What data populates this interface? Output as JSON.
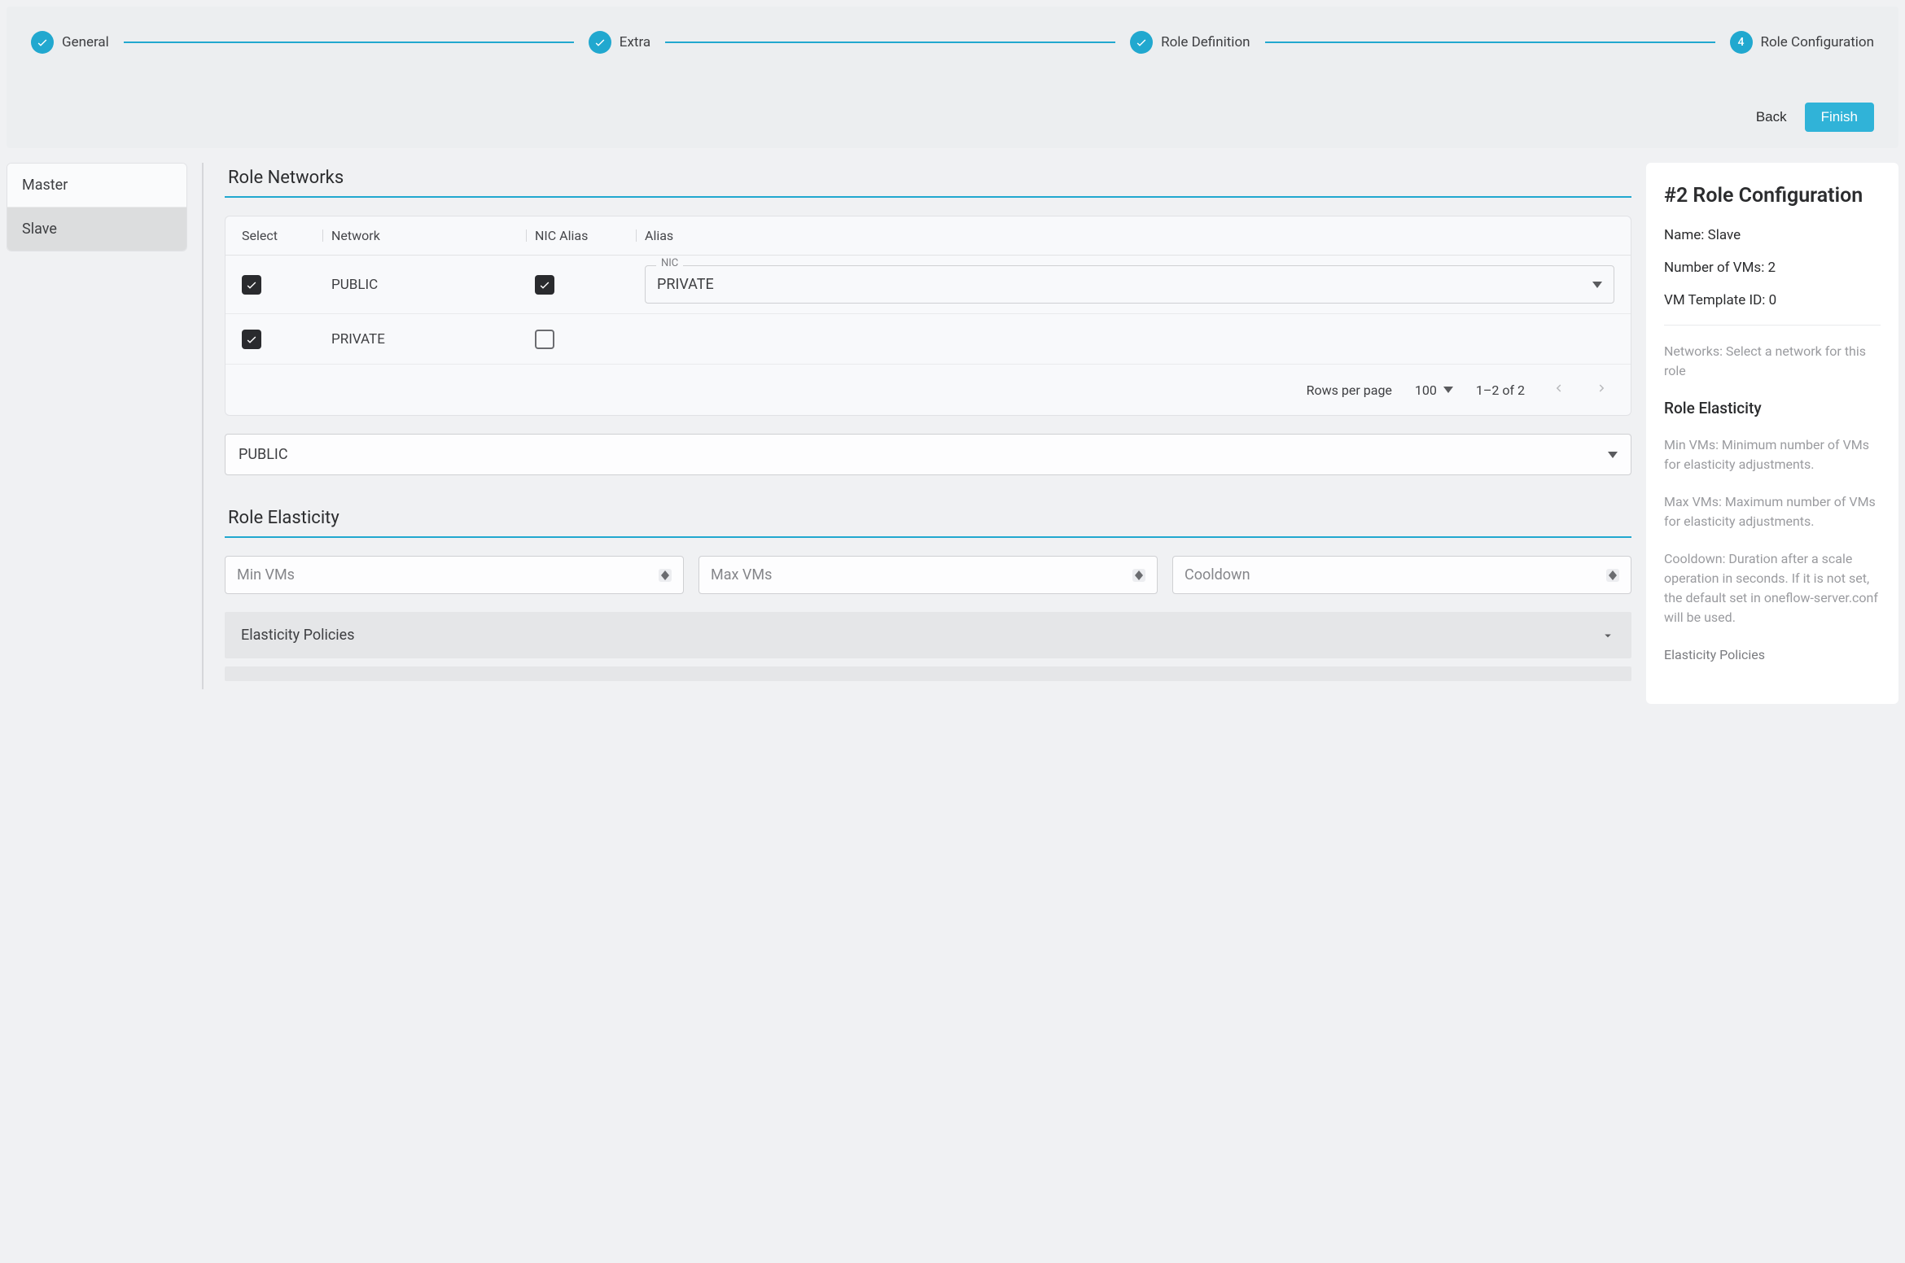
{
  "wizard": {
    "steps": [
      {
        "label": "General",
        "done": true
      },
      {
        "label": "Extra",
        "done": true
      },
      {
        "label": "Role Definition",
        "done": true
      },
      {
        "label": "Role Configuration",
        "done": false,
        "number": "4"
      }
    ],
    "back_label": "Back",
    "finish_label": "Finish"
  },
  "roles": [
    {
      "name": "Master",
      "active": false
    },
    {
      "name": "Slave",
      "active": true
    }
  ],
  "networks_section": {
    "title": "Role Networks",
    "columns": {
      "select": "Select",
      "network": "Network",
      "nic_alias": "NIC Alias",
      "alias": "Alias"
    },
    "rows": [
      {
        "selected": true,
        "network": "PUBLIC",
        "nic_alias_checked": true,
        "alias_legend": "NIC",
        "alias_value": "PRIVATE"
      },
      {
        "selected": true,
        "network": "PRIVATE",
        "nic_alias_checked": false
      }
    ],
    "footer": {
      "rows_per_page_label": "Rows per page",
      "rows_per_page_value": "100",
      "range": "1–2 of 2"
    },
    "main_select_value": "PUBLIC"
  },
  "elasticity_section": {
    "title": "Role Elasticity",
    "min_vms_placeholder": "Min VMs",
    "max_vms_placeholder": "Max VMs",
    "cooldown_placeholder": "Cooldown",
    "accordion_label": "Elasticity Policies"
  },
  "info_panel": {
    "title": "#2 Role Configuration",
    "name_label": "Name:",
    "name_value": "Slave",
    "num_vms_label": "Number of VMs:",
    "num_vms_value": "2",
    "template_label": "VM Template ID:",
    "template_value": "0",
    "networks_help_label": "Networks:",
    "networks_help_text": "Select a network for this role",
    "elasticity_title": "Role Elasticity",
    "min_vms_help_label": "Min VMs:",
    "min_vms_help_text": "Minimum number of VMs for elasticity adjustments.",
    "max_vms_help_label": "Max VMs:",
    "max_vms_help_text": "Maximum number of VMs for elasticity adjustments.",
    "cooldown_help_label": "Cooldown:",
    "cooldown_help_text": "Duration after a scale operation in seconds. If it is not set, the default set in oneflow-server.conf will be used.",
    "policies_label": "Elasticity Policies"
  }
}
